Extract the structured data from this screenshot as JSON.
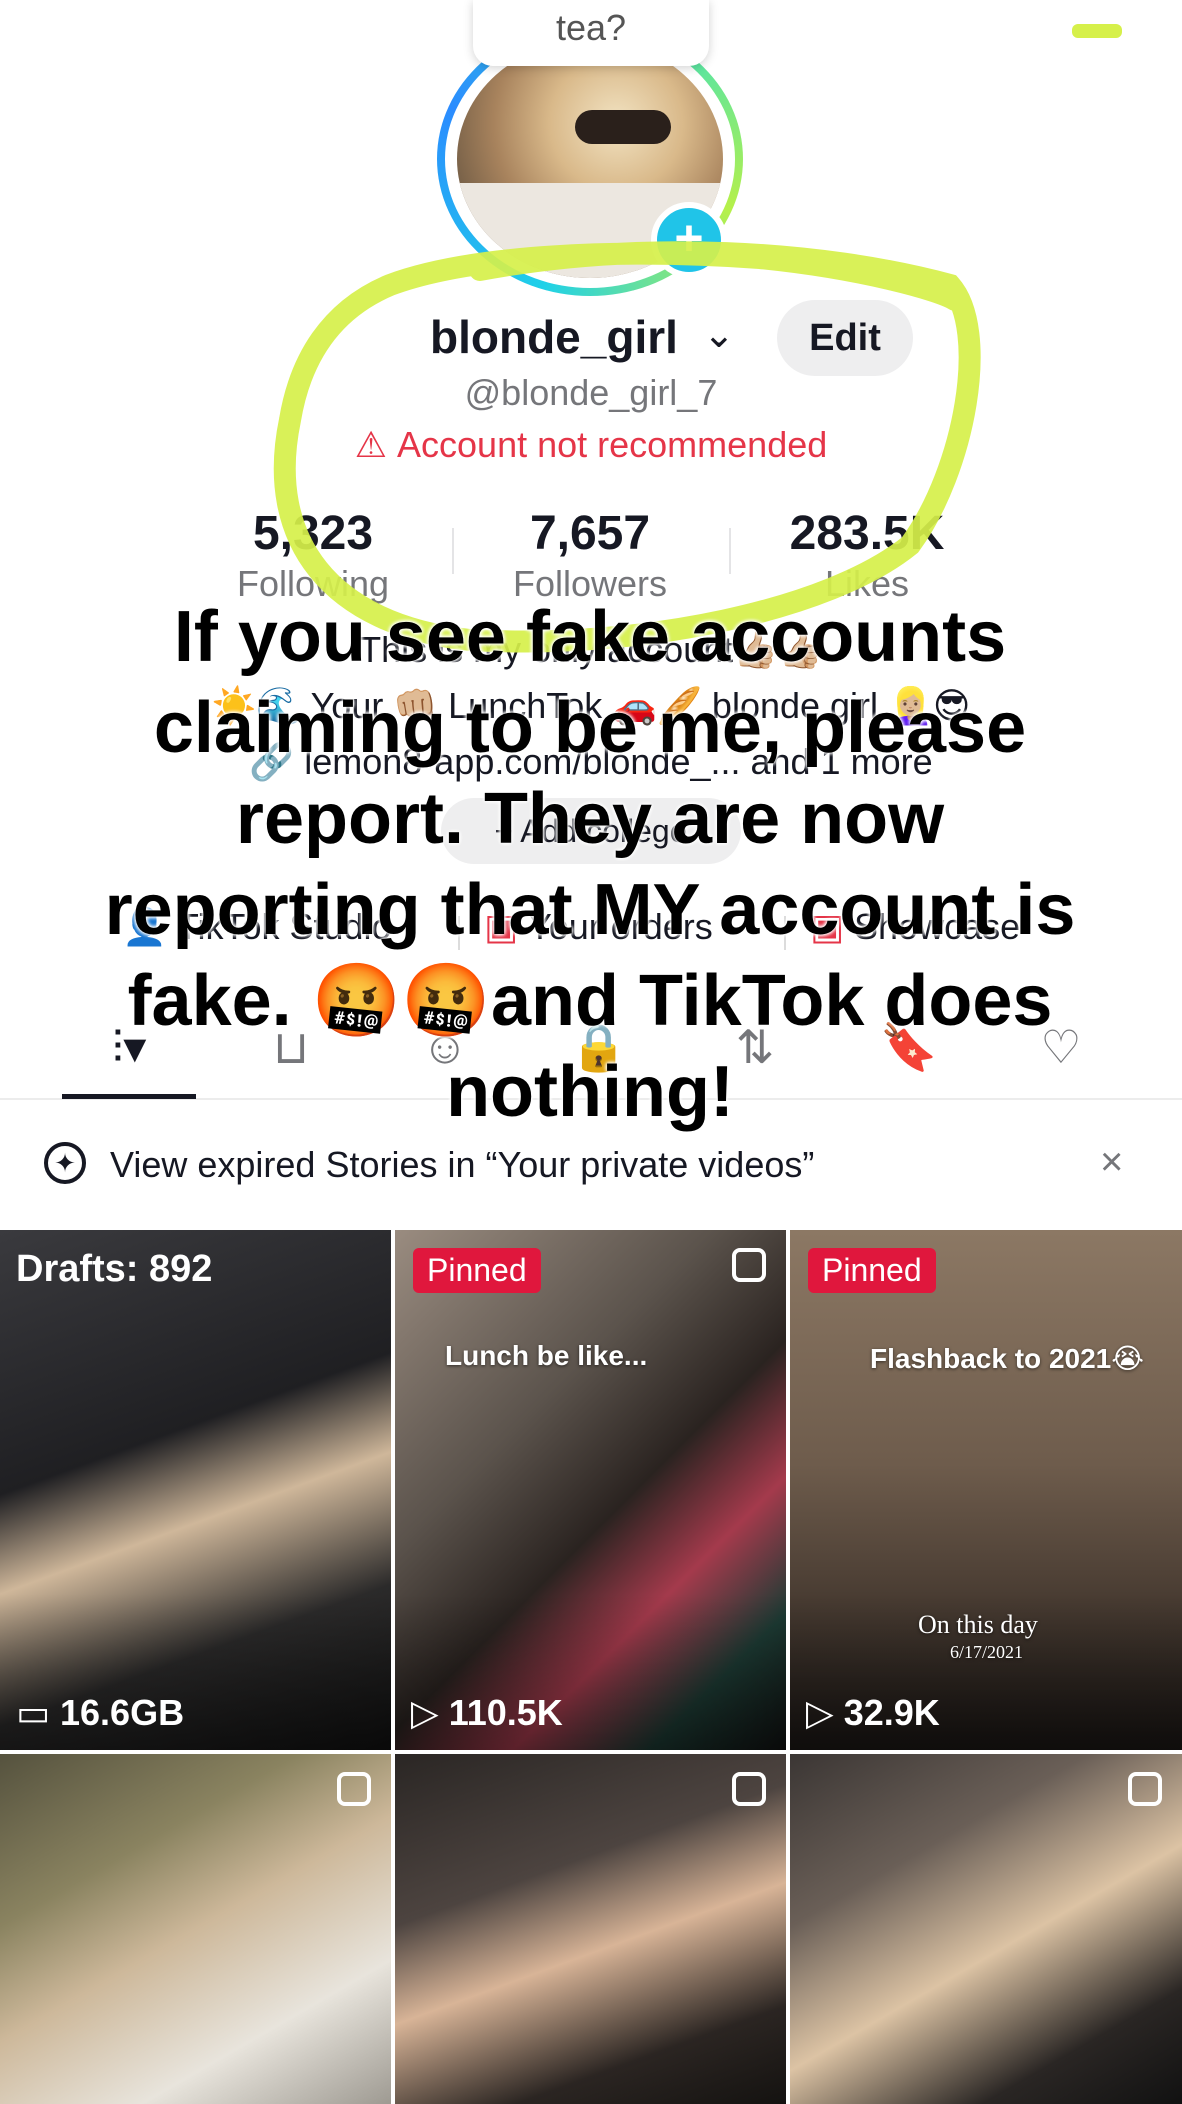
{
  "profile": {
    "note": "tea?",
    "username": "blonde_girl",
    "handle": "@blonde_girl_7",
    "warning": "Account not recommended",
    "edit_label": "Edit",
    "stats": [
      {
        "value": "5,323",
        "label": "Following"
      },
      {
        "value": "7,657",
        "label": "Followers"
      },
      {
        "value": "283.5K",
        "label": "Likes"
      }
    ],
    "bio": [
      "This is my only account👍🏼👍🏼",
      "☀️🌊 Your 👊🏼 LunchTok 🚗🥖 blonde girl 👱🏼‍♀️😎",
      "🔗 lemon8-app.com/blonde_...   and 1 more"
    ],
    "college_button": "+ Add college",
    "links": [
      "TikTok Studio",
      "Your orders",
      "Showcase"
    ]
  },
  "tabs": [
    {
      "name": "videos",
      "icon": "grid-icon"
    },
    {
      "name": "shop",
      "icon": "bag-icon"
    },
    {
      "name": "reposts-friends",
      "icon": "faces-icon"
    },
    {
      "name": "private",
      "icon": "lock-icon"
    },
    {
      "name": "reposts",
      "icon": "repost-icon"
    },
    {
      "name": "favorites",
      "icon": "bookmark-icon"
    },
    {
      "name": "liked",
      "icon": "heart-icon"
    }
  ],
  "banner": {
    "text": "View expired Stories in “Your private videos”"
  },
  "grid": [
    {
      "drafts": "Drafts: 892",
      "stat": "16.6GB",
      "caption": ""
    },
    {
      "pinned": "Pinned",
      "stat": "110.5K",
      "caption": "Lunch be like..."
    },
    {
      "pinned": "Pinned",
      "stat": "32.9K",
      "caption": "Flashback to 2021😭",
      "caption2": "On this day",
      "caption3": "6/17/2021"
    },
    {
      "stat": ""
    },
    {
      "stat": ""
    },
    {
      "stat": ""
    }
  ],
  "caption_overlay": "If you see fake accounts claiming to be me, please report. They are now reporting that MY account is fake. 🤬🤬and TikTok does nothing!",
  "colors": {
    "warning": "#e53548",
    "pinned": "#e0173d",
    "highlight": "#d6f04a",
    "ring": "#20c4e8"
  }
}
